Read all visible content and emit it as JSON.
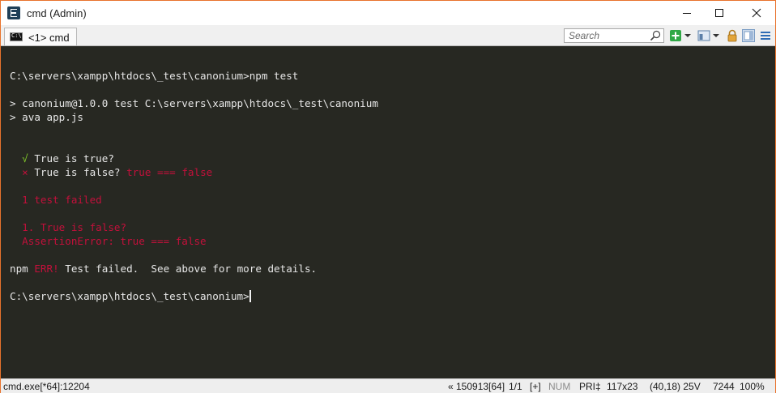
{
  "window": {
    "title": "cmd (Admin)"
  },
  "tabs": [
    {
      "label": "<1> cmd"
    }
  ],
  "toolbar": {
    "search_placeholder": "Search",
    "icons": [
      "search-icon",
      "add-console-icon",
      "chevron-down-icon",
      "view-icon",
      "chevron-down-icon",
      "lock-icon",
      "panel-icon",
      "menu-icon"
    ]
  },
  "console": {
    "lines": [
      {
        "parts": [
          {
            "text": "C:\\servers\\xampp\\htdocs\\_test\\canonium>npm test",
            "style": "normal"
          }
        ]
      },
      {
        "parts": [
          {
            "text": "> canonium@1.0.0 test C:\\servers\\xampp\\htdocs\\_test\\canonium",
            "style": "normal"
          }
        ]
      },
      {
        "parts": [
          {
            "text": "> ava app.js",
            "style": "normal"
          }
        ]
      },
      {
        "parts": [
          {
            "text": "  ",
            "style": "normal"
          },
          {
            "text": "√",
            "style": "ok"
          },
          {
            "text": " True is true?",
            "style": "normal"
          }
        ]
      },
      {
        "parts": [
          {
            "text": "  ",
            "style": "normal"
          },
          {
            "text": "×",
            "style": "err"
          },
          {
            "text": " True is false? ",
            "style": "normal"
          },
          {
            "text": "true === false",
            "style": "err"
          }
        ]
      },
      {
        "parts": [
          {
            "text": "  1 test failed",
            "style": "err"
          }
        ]
      },
      {
        "parts": [
          {
            "text": "  1. True is false?",
            "style": "err"
          }
        ]
      },
      {
        "parts": [
          {
            "text": "  AssertionError: true === false",
            "style": "err"
          }
        ]
      },
      {
        "parts": [
          {
            "text": "npm ",
            "style": "normal"
          },
          {
            "text": "ERR!",
            "style": "err"
          },
          {
            "text": " Test failed.  See above for more details.",
            "style": "normal"
          }
        ]
      },
      {
        "parts": [
          {
            "text": "C:\\servers\\xampp\\htdocs\\_test\\canonium>",
            "style": "normal"
          }
        ],
        "cursor": true
      }
    ]
  },
  "statusbar": {
    "process": "cmd.exe[*64]:12204",
    "buffer": "« 150913[64]",
    "console_index": "1/1",
    "plus": "[+]",
    "num": "NUM",
    "pri": "PRI‡",
    "size": "117x23",
    "cursor_pos": "(40,18) 25V",
    "pid": "7244",
    "zoom": "100%"
  },
  "colors": {
    "console_bg": "#272822",
    "console_text": "#e6e6e6",
    "ok": "#7ec32a",
    "error": "#c3103b",
    "window_border": "#e8732c"
  }
}
